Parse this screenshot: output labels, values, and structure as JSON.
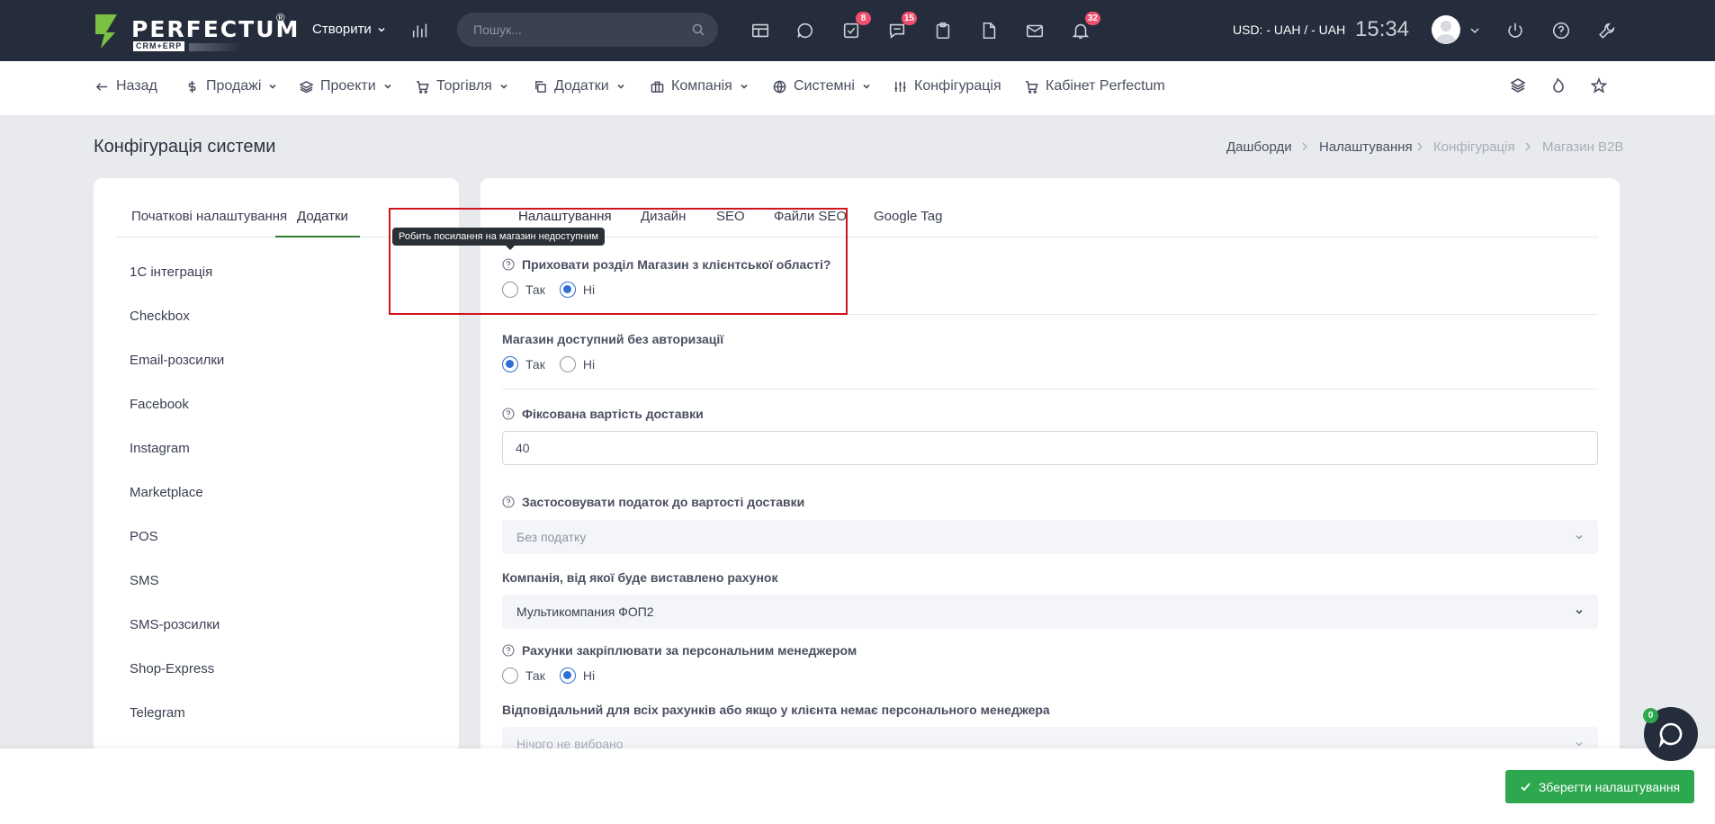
{
  "app": {
    "logo_text": "PERFECTUM",
    "logo_reg": "®",
    "logo_sub": "CRM+ERP"
  },
  "topbar": {
    "create_label": "Створити",
    "search_placeholder": "Пошук...",
    "badges": {
      "tasks": "8",
      "chat": "15",
      "notifications": "32"
    },
    "currency": "USD: - UAH / - UAH",
    "time": "15:34"
  },
  "menu": {
    "back": "Назад",
    "sales": "Продажі",
    "projects": "Проекти",
    "trade": "Торгівля",
    "addons": "Додатки",
    "company": "Компанія",
    "system": "Системні",
    "config": "Конфігурація",
    "cabinet": "Кабінет Perfectum"
  },
  "page": {
    "title": "Конфігурація системи",
    "breadcrumb": [
      "Дашборди",
      "Налаштування",
      "Конфігурація",
      "Магазин B2B"
    ]
  },
  "left": {
    "tabs": [
      "Початкові налаштування",
      "Додатки"
    ],
    "items": [
      "1С інтеграція",
      "Checkbox",
      "Email-розсилки",
      "Facebook",
      "Instagram",
      "Marketplace",
      "POS",
      "SMS",
      "SMS-розсилки",
      "Shop-Express",
      "Telegram"
    ]
  },
  "right": {
    "tabs": [
      "Налаштування",
      "Дизайн",
      "SEO",
      "Файли SEO",
      "Google Tag"
    ],
    "tooltip": "Робить посилання на магазин недоступним",
    "yes": "Так",
    "no": "Ні",
    "f1_label": "Приховати розділ Магазин з клієнтської області?",
    "f1_value": "no",
    "f2_label": "Магазин доступний без авторизації",
    "f2_value": "yes",
    "f3_label": "Фіксована вартість доставки",
    "f3_value": "40",
    "f4_label": "Застосовувати податок до вартості доставки",
    "f4_value": "Без податку",
    "f5_label": "Компанія, від якої буде виставлено рахунок",
    "f5_value": "Мультикомпания ФОП2",
    "f6_label": "Рахунки закріплювати за персональним менеджером",
    "f6_value": "no",
    "f7_label": "Відповідальний для всіх рахунків або якщо у клієнта немає персонального менеджера",
    "f7_value": "Нічого не вибрано"
  },
  "footer": {
    "save_label": "Зберегти налаштування",
    "chat_badge": "0"
  },
  "colors": {
    "topbar": "#252c3b",
    "accent_green": "#2ea84f",
    "radio_blue": "#2f6fd6",
    "highlight_red": "#d0141c",
    "badge_red": "#f0506e"
  }
}
